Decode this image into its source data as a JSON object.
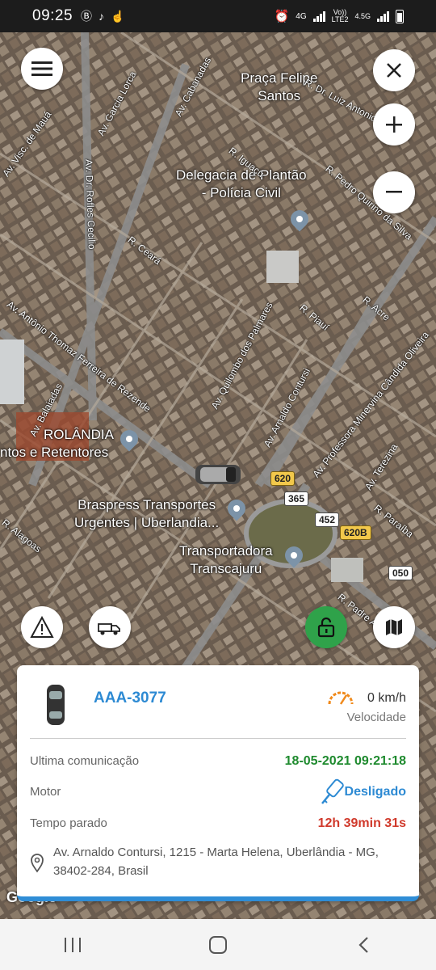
{
  "status_bar": {
    "time": "09:25",
    "network_type": "4G",
    "network_sub_top": "Vo))",
    "network_sub_bottom": "LTE2",
    "network_4_5g": "4.5G"
  },
  "map": {
    "places": [
      {
        "label": "Praça Felipe\nSantos"
      },
      {
        "label": "Delegacia de Plantão\n- Polícia Civil"
      },
      {
        "label": "ROLÂNDIA"
      },
      {
        "label": "ntos e Retentores"
      },
      {
        "label": "Braspress Transportes\nUrgentes | Uberlandia..."
      },
      {
        "label": "Transportadora\nTranscajuru"
      }
    ],
    "streets": [
      "R. Dr. Luiz Antonio Waack",
      "Av. Cabanadas",
      "Av. Garcia Lorca",
      "Av. Visc. de Mauá",
      "Av. Dr. Rofles Cecilio",
      "R. Iguaçu",
      "R. Pedro Quirino da Silva",
      "R. Ceará",
      "Av. Antônio Thomaz Ferreira de Rezende",
      "R. Piauí",
      "R. Acre",
      "Av. Quilombo dos Palmares",
      "Av. Arnaldo Contursi",
      "Av. Professora Minervina Cândida Oliveira",
      "Av. Balaiadas",
      "Av. Terezina",
      "R. Paraíba",
      "R. Alagoas",
      "R. Padre A..."
    ],
    "road_shields": [
      "620",
      "365",
      "452",
      "620B",
      "050"
    ],
    "attribution": "Google"
  },
  "info_card": {
    "plate": "AAA-3077",
    "speed_value": "0 km/h",
    "speed_label": "Velocidade",
    "last_comm_label": "Ultima comunicação",
    "last_comm_value": "18-05-2021 09:21:18",
    "motor_label": "Motor",
    "motor_value": "Desligado",
    "stopped_label": "Tempo parado",
    "stopped_value": "12h 39min 31s",
    "address": "Av. Arnaldo Contursi, 1215 - Marta Helena, Uberlândia - MG, 38402-284, Brasil"
  },
  "colors": {
    "accent_blue": "#2d8ad3",
    "green_ok": "#1e8a2e",
    "red_time": "#d0392b",
    "lock_green": "#2fa24a",
    "speedometer_orange": "#f08a1c"
  },
  "icons": {
    "menu": "hamburger-menu-icon",
    "close": "close-icon",
    "zoom_in": "plus-icon",
    "zoom_out": "minus-icon",
    "alert": "warning-signal-icon",
    "tow": "tow-truck-icon",
    "lock": "lock-icon",
    "map_layers": "map-icon",
    "car": "car-icon",
    "speedometer": "speedometer-icon",
    "key": "car-key-icon",
    "location": "location-pin-icon"
  }
}
